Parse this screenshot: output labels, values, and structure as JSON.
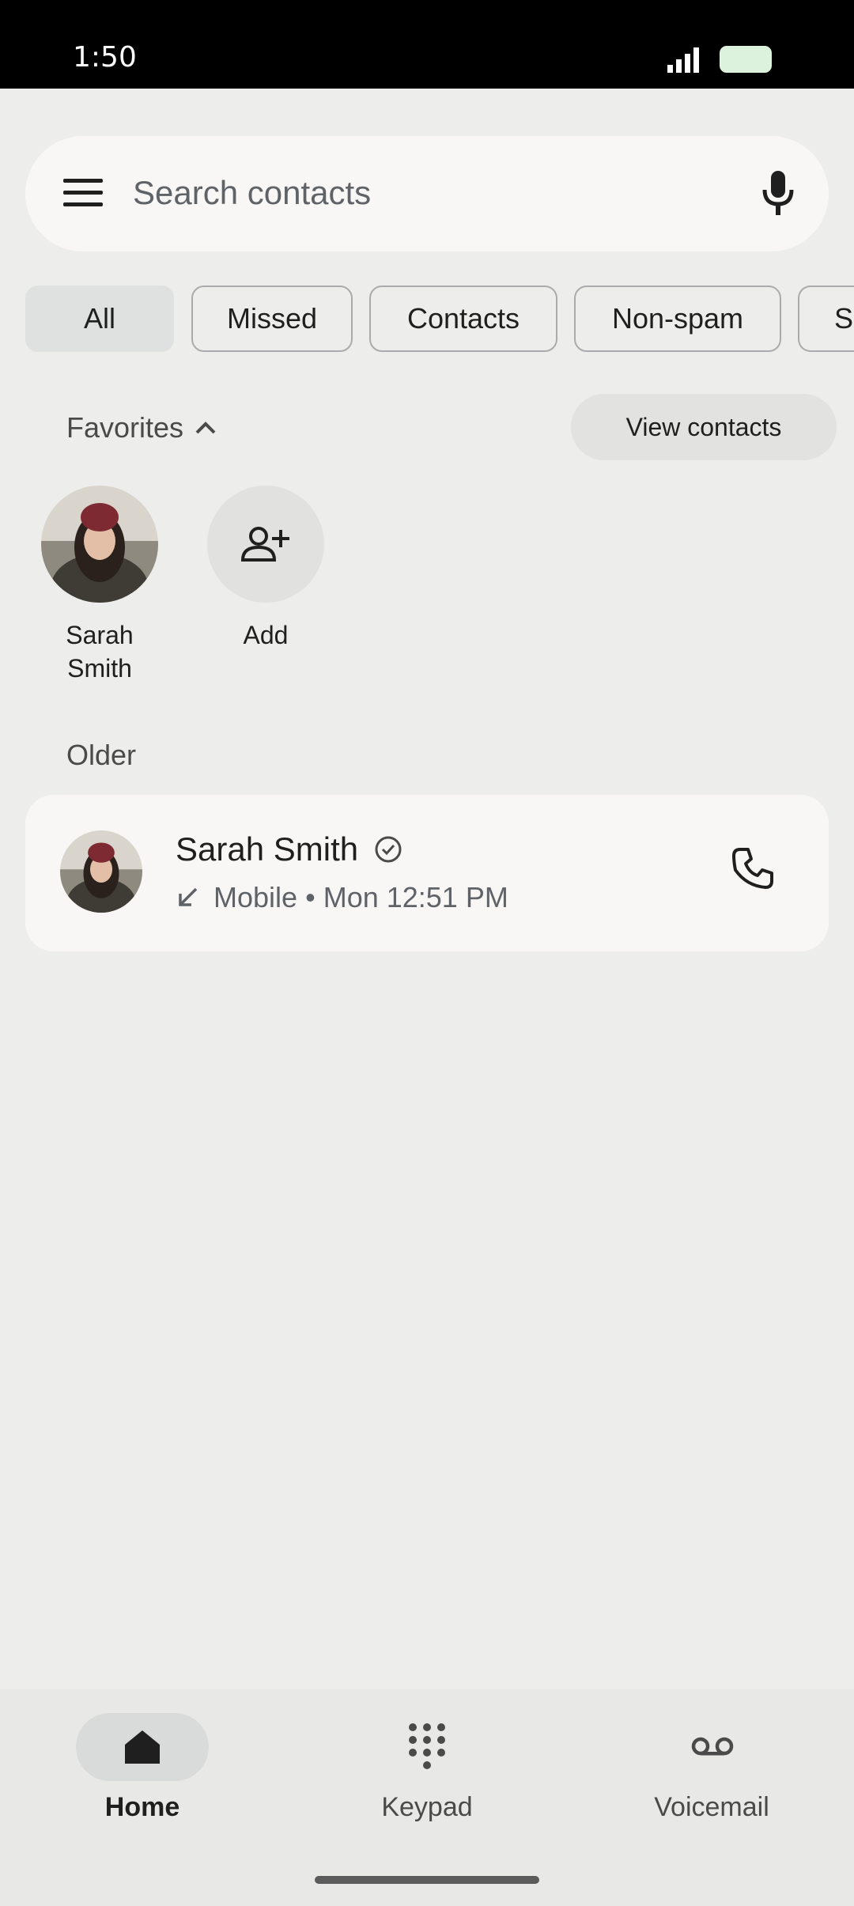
{
  "status_bar": {
    "time": "1:50"
  },
  "search": {
    "placeholder": "Search contacts"
  },
  "filters": [
    {
      "label": "All",
      "selected": true
    },
    {
      "label": "Missed",
      "selected": false
    },
    {
      "label": "Contacts",
      "selected": false
    },
    {
      "label": "Non-spam",
      "selected": false
    },
    {
      "label": "Sp",
      "selected": false
    }
  ],
  "favorites": {
    "header": "Favorites",
    "view_contacts_label": "View contacts",
    "items": [
      {
        "name_line1": "Sarah",
        "name_line2": "Smith"
      }
    ],
    "add_label": "Add"
  },
  "sections": [
    {
      "label": "Older",
      "calls": [
        {
          "name": "Sarah Smith",
          "type": "Mobile",
          "separator": "•",
          "time": "Mon 12:51 PM",
          "direction": "incoming"
        }
      ]
    }
  ],
  "bottom_nav": [
    {
      "label": "Home",
      "icon": "home-icon",
      "active": true
    },
    {
      "label": "Keypad",
      "icon": "dialpad-icon",
      "active": false
    },
    {
      "label": "Voicemail",
      "icon": "voicemail-icon",
      "active": false
    }
  ],
  "colors": {
    "background": "#EDEDEB",
    "card": "#F8F7F5",
    "chip_selected": "#DFE1E1"
  }
}
